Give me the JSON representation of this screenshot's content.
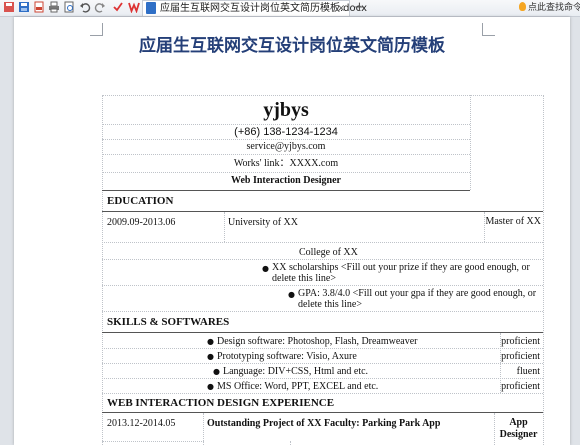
{
  "toolbar": {
    "icons": [
      "save-icon",
      "save-icon",
      "pdf-icon",
      "print-icon",
      "print-preview-icon",
      "undo-icon",
      "redo-icon",
      "check-icon",
      "wps-logo-icon"
    ],
    "tab": {
      "title": "应届生互联网交互设计岗位英文简历模板.docx",
      "close": "×"
    },
    "add_tab": "+",
    "search": "点此查找命令"
  },
  "document": {
    "title": "应届生互联网交互设计岗位英文简历模板",
    "name": "yjbys",
    "phone": "(+86) 138-1234-1234",
    "email": "service@yjbys.com",
    "works_link": "Works' link：XXXX.com",
    "position": "Web Interaction Designer",
    "sections": {
      "education": "EDUCATION",
      "skills": "SKILLS & SOFTWARES",
      "experience": "WEB INTERACTION DESIGN EXPERIENCE"
    },
    "education": {
      "period": "2009.09-2013.06",
      "school": "University of XX",
      "degree": "Master of XX",
      "college": "College of XX",
      "bullets": [
        "XX scholarships <Fill out your prize if they are good enough, or delete this line>",
        "GPA: 3.8/4.0 <Fill out your gpa if they are good enough, or delete this line>"
      ]
    },
    "skills": [
      {
        "text": "Design software: Photoshop, Flash, Dreamweaver",
        "level": "proficient"
      },
      {
        "text": "Prototyping software: Visio, Axure",
        "level": "proficient"
      },
      {
        "text": "Language: DIV+CSS, Html and etc.",
        "level": "fluent"
      },
      {
        "text": "MS Office: Word, PPT, EXCEL and etc.",
        "level": "proficient"
      }
    ],
    "experience": {
      "period": "2013.12-2014.05",
      "project": "Outstanding Project of XX Faculty: Parking Park App",
      "role": "App Designer"
    }
  }
}
